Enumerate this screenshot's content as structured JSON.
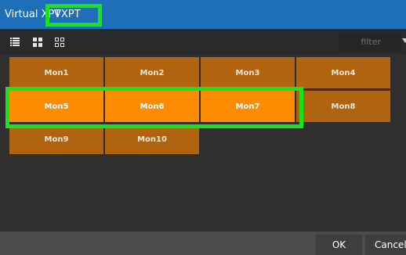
{
  "tabs": [
    {
      "label": "Virtual XPT"
    },
    {
      "label": "VXPT"
    }
  ],
  "toolbar": {
    "filter_placeholder": "filter",
    "icons": [
      "list-view-icon",
      "large-grid-view-icon",
      "small-grid-view-icon",
      "chevron-down-icon"
    ]
  },
  "monitors": [
    {
      "label": "Mon1",
      "selected": false
    },
    {
      "label": "Mon2",
      "selected": false
    },
    {
      "label": "Mon3",
      "selected": false
    },
    {
      "label": "Mon4",
      "selected": false
    },
    {
      "label": "Mon5",
      "selected": true
    },
    {
      "label": "Mon6",
      "selected": true
    },
    {
      "label": "Mon7",
      "selected": true
    },
    {
      "label": "Mon8",
      "selected": false
    },
    {
      "label": "Mon9",
      "selected": false
    },
    {
      "label": "Mon10",
      "selected": false
    }
  ],
  "footer": {
    "ok_label": "OK",
    "cancel_label": "Cancel"
  },
  "colors": {
    "tab_bar": "#1d6fb8",
    "tile": "#b0640f",
    "tile_selected": "#ff8c00",
    "highlight": "#19e319"
  }
}
